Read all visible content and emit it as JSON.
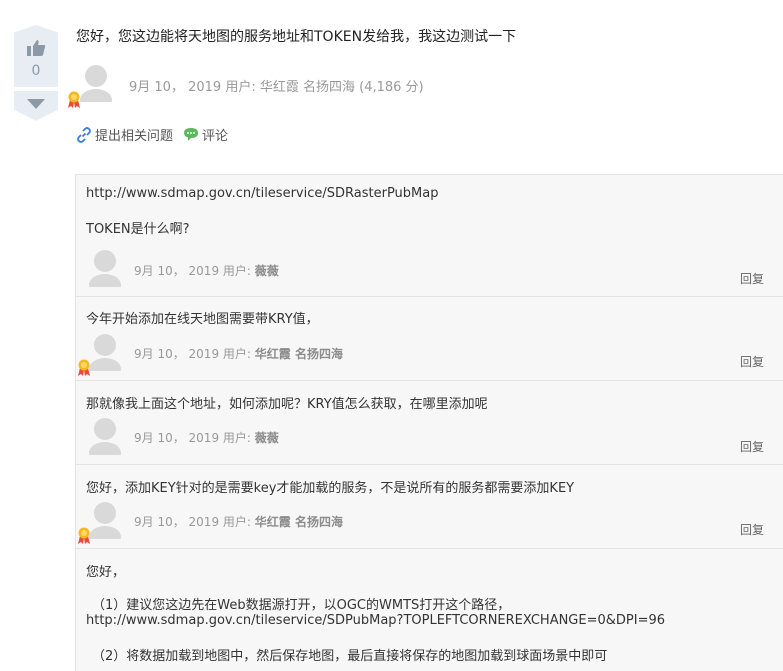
{
  "vote": {
    "count": "0"
  },
  "question": {
    "text": "您好，您这边能将天地图的服务地址和TOKEN发给我，我这边测试一下",
    "date": "9月 10， 2019",
    "user_label": "用户:",
    "user_name": "华红霞 名扬四海",
    "points": "(4,186 分)"
  },
  "actions": {
    "related": "提出相关问题",
    "comment": "评论"
  },
  "comments": [
    {
      "lines": [
        "http://www.sdmap.gov.cn/tileservice/SDRasterPubMap",
        "TOKEN是什么啊?"
      ],
      "date": "9月 10， 2019",
      "user_label": "用户:",
      "user_name": "薇薇",
      "reply": "回复"
    },
    {
      "lines": [
        "今年开始添加在线天地图需要带KRY值，"
      ],
      "date": "9月 10， 2019",
      "user_label": "用户:",
      "user_name": "华红霞 名扬四海",
      "reply": "回复"
    },
    {
      "lines": [
        "那就像我上面这个地址，如何添加呢？KRY值怎么获取，在哪里添加呢"
      ],
      "date": "9月 10， 2019",
      "user_label": "用户:",
      "user_name": "薇薇",
      "reply": "回复"
    },
    {
      "lines": [
        "您好，添加KEY针对的是需要key才能加载的服务，不是说所有的服务都需要添加KEY"
      ],
      "date": "9月 10， 2019",
      "user_label": "用户:",
      "user_name": "华红霞 名扬四海",
      "reply": "回复"
    },
    {
      "lines": [
        "您好，",
        "（1）建议您这边先在Web数据源打开，以OGC的WMTS打开这个路径，",
        "http://www.sdmap.gov.cn/tileservice/SDPubMap?TOPLEFTCORNEREXCHANGE=0&DPI=96",
        "（2）将数据加载到地图中，然后保存地图，最后直接将保存的地图加载到球面场景中即可"
      ]
    }
  ]
}
